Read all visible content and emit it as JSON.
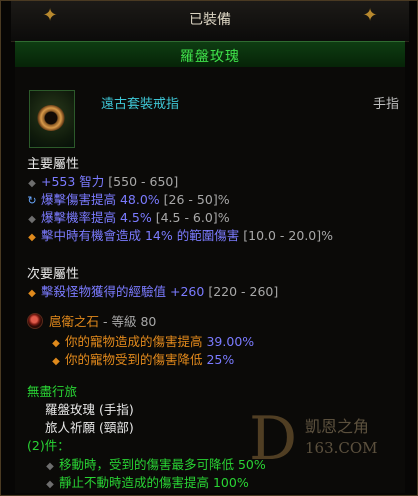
{
  "header": {
    "title": "已裝備"
  },
  "item": {
    "name": "羅盤玫瑰",
    "type": "遠古套裝戒指",
    "slot": "手指",
    "icon": "ring-icon"
  },
  "primary": {
    "title": "主要屬性",
    "lines": [
      {
        "value": "+553 智力",
        "range": "[550 - 650]"
      },
      {
        "value": "爆擊傷害提高 48.0%",
        "range": "[26 - 50]%"
      },
      {
        "value": "爆擊機率提高 4.5%",
        "range": "[4.5 - 6.0]%"
      },
      {
        "prefix": "擊中時有機會造成 ",
        "value": "14%",
        "suffix": " 的範圍傷害",
        "range": "[10.0 - 20.0]%"
      }
    ]
  },
  "secondary": {
    "title": "次要屬性",
    "lines": [
      {
        "prefix": "擊殺怪物獲得的經驗值 ",
        "value": "+260",
        "range": "[220 - 260]"
      }
    ]
  },
  "legendary": {
    "gem_name": "扈衛之石",
    "level_text": " - 等級 80",
    "lines": [
      {
        "prefix": "你的寵物造成的傷害提高 ",
        "value": "39.00%"
      },
      {
        "prefix": "你的寵物受到的傷害降低 ",
        "value": "25%"
      }
    ]
  },
  "set": {
    "name": "無盡行旅",
    "pieces": [
      "羅盤玫瑰 (手指)",
      "旅人祈願 (頸部)"
    ],
    "bonus_label": "(2)件：",
    "bonuses": [
      "移動時，受到的傷害最多可降低 50%",
      "靜止不動時造成的傷害提高 100%"
    ]
  },
  "watermark": {
    "letter": "D",
    "text1": "凱恩之角",
    "text2": "163.COM"
  }
}
